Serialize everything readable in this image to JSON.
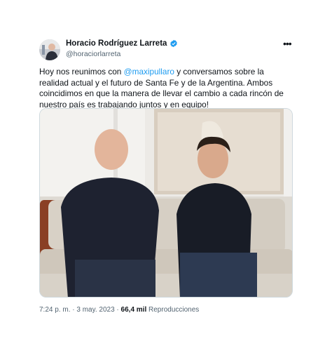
{
  "author": {
    "display_name": "Horacio Rodríguez Larreta",
    "handle": "@horaciorlarreta",
    "verified_icon": "verified-badge-icon"
  },
  "menu_icon": "more-options-icon",
  "more_label": "•••",
  "tweet": {
    "text_before": "Hoy nos reunimos con ",
    "mention": "@maxipullaro",
    "text_after": " y conversamos sobre la realidad actual y el futuro de Santa Fe y de la Argentina. Ambos coincidimos en que la manera de llevar el cambio a cada rincón de nuestro país es trabajando juntos y en equipo!"
  },
  "meta": {
    "time": "7:24 p. m.",
    "separator1": " · ",
    "date": "3 may. 2023",
    "separator2": " · ",
    "views_count": "66,4 mil",
    "views_label": " Reproducciones"
  },
  "colors": {
    "accent": "#1d9bf0",
    "text": "#0f1419",
    "muted": "#536471"
  }
}
